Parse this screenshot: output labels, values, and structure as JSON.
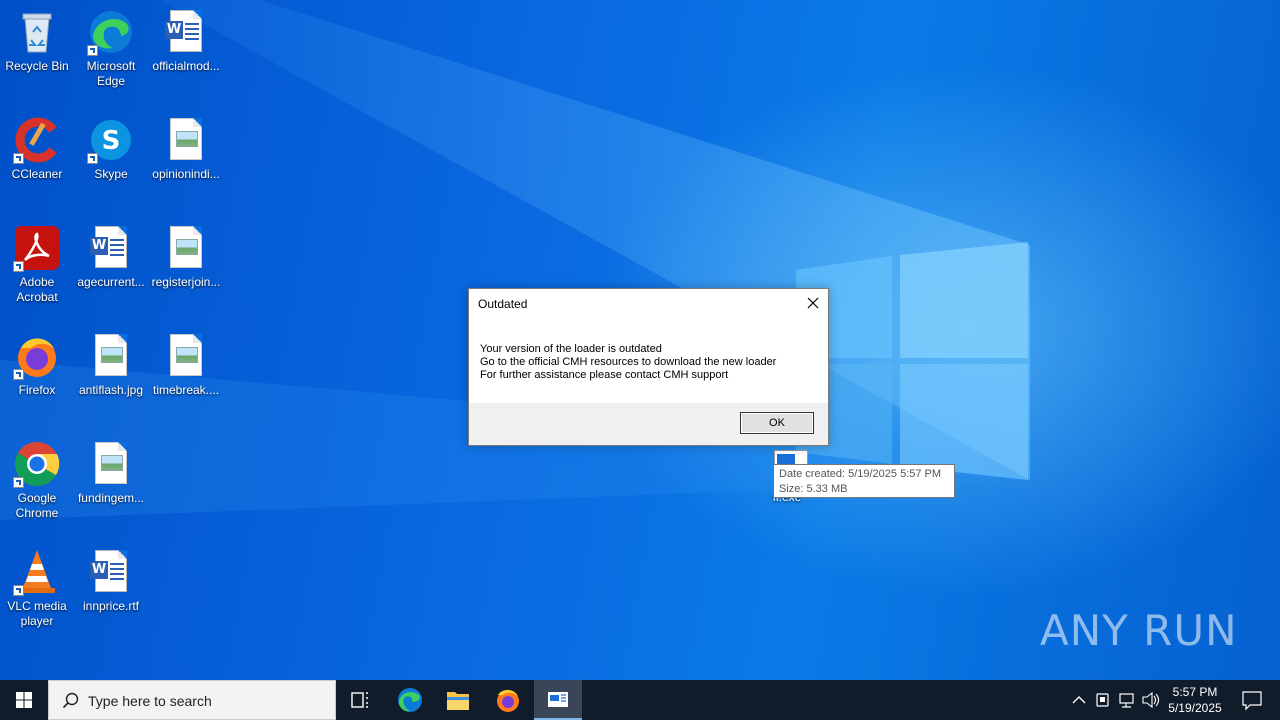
{
  "desktop": {
    "icons": [
      {
        "label": "Recycle Bin"
      },
      {
        "label": "Microsoft Edge"
      },
      {
        "label": "officialmod..."
      },
      {
        "label": "CCleaner"
      },
      {
        "label": "Skype"
      },
      {
        "label": "opinionindi..."
      },
      {
        "label": "Adobe Acrobat"
      },
      {
        "label": "agecurrent..."
      },
      {
        "label": "registerjoin..."
      },
      {
        "label": "Firefox"
      },
      {
        "label": "antiflash.jpg"
      },
      {
        "label": "timebreak...."
      },
      {
        "label": "Google Chrome"
      },
      {
        "label": "fundingem..."
      },
      {
        "label": "VLC media player"
      },
      {
        "label": "innprice.rtf"
      }
    ],
    "file_label": "fi.exe",
    "tooltip": {
      "date_created": "Date created: 5/19/2025 5:57 PM",
      "size": "Size: 5.33 MB"
    },
    "watermark": "ANY RUN"
  },
  "dialog": {
    "title": "Outdated",
    "lines": [
      "Your version of the loader is outdated",
      "Go to the official CMH resources to download the new loader",
      "For further assistance please contact CMH support"
    ],
    "ok_label": "OK"
  },
  "taskbar": {
    "search_placeholder": "Type here to search",
    "apps": [
      "task-view",
      "microsoft-edge",
      "file-explorer",
      "firefox",
      "active-window"
    ],
    "clock": {
      "time": "5:57 PM",
      "date": "5/19/2025"
    }
  },
  "colors": {
    "desktop_blue": "#0a68e0",
    "taskbar": "#111c2b",
    "dialog_footer": "#f0f0f0"
  }
}
